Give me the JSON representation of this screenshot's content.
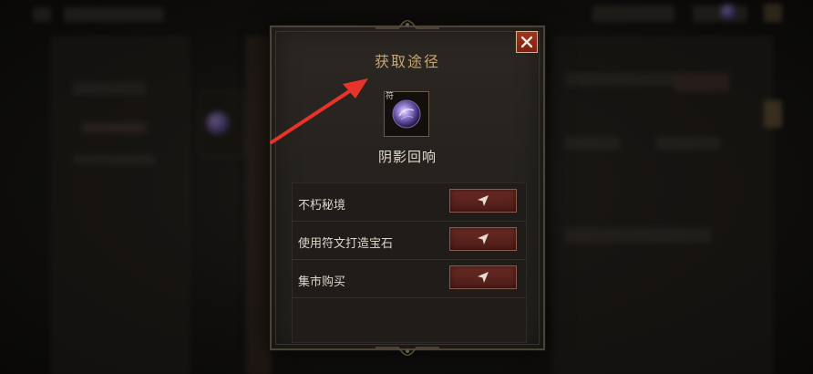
{
  "dialog": {
    "title": "获取途径",
    "close_icon": "close-icon"
  },
  "item": {
    "badge": "符",
    "name": "阴影回响",
    "icon": "purple-orb-gem-icon"
  },
  "sources": [
    {
      "label": "不朽秘境",
      "action_icon": "send-arrow-icon"
    },
    {
      "label": "使用符文打造宝石",
      "action_icon": "send-arrow-icon"
    },
    {
      "label": "集市购买",
      "action_icon": "send-arrow-icon"
    }
  ],
  "colors": {
    "title": "#c9a56e",
    "close_button": "#a0341f",
    "go_button": "#5a221d",
    "annotation_arrow": "#e8332a"
  }
}
